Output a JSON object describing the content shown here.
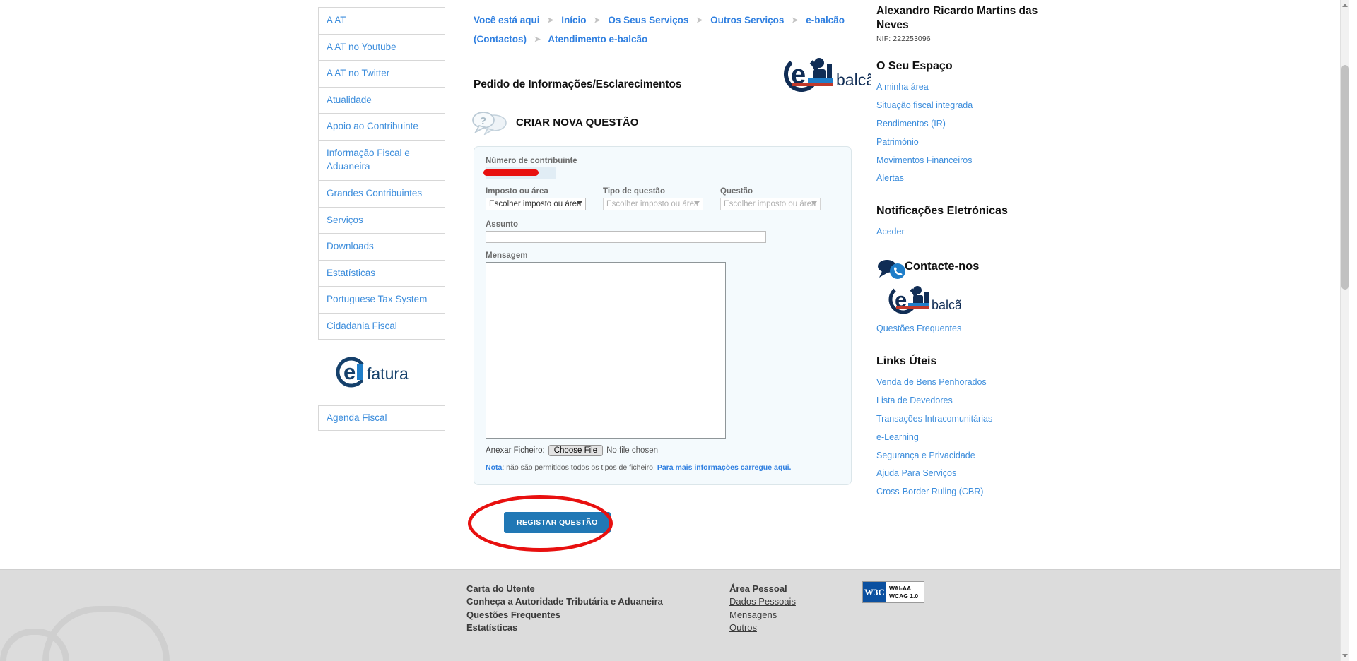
{
  "breadcrumb": {
    "prefix": "Você está aqui",
    "items": [
      "Início",
      "Os Seus Serviços",
      "Outros Serviços",
      "e-balcão (Contactos)",
      "Atendimento e-balcão"
    ]
  },
  "left_nav": {
    "items": [
      "A AT",
      "A AT no Youtube",
      "A AT no Twitter",
      "Atualidade",
      "Apoio ao Contribuinte",
      "Informação Fiscal e Aduaneira",
      "Grandes Contribuintes",
      "Serviços",
      "Downloads",
      "Estatísticas",
      "Portuguese Tax System",
      "Cidadania Fiscal"
    ],
    "efatura_logo_text": "efatura",
    "agenda": "Agenda Fiscal"
  },
  "main": {
    "page_title": "Pedido de Informações/Esclarecimentos",
    "logo_text": "balcão",
    "section_title": "CRIAR NOVA QUESTÃO",
    "form": {
      "nif_label": "Número de contribuinte",
      "nif_value": "",
      "imposto_label": "Imposto ou área",
      "imposto_value": "Escolher imposto ou área",
      "tipo_label": "Tipo de questão",
      "tipo_value": "Escolher imposto ou área",
      "questao_label": "Questão",
      "questao_value": "Escolher imposto ou área",
      "assunto_label": "Assunto",
      "assunto_value": "",
      "mensagem_label": "Mensagem",
      "mensagem_value": "",
      "attach_label": "Anexar Ficheiro:",
      "choose_file": "Choose File",
      "no_file": "No file chosen",
      "note_prefix": "Nota",
      "note_text": ": não são permitidos todos os tipos de ficheiro.",
      "note_link": "Para mais informações carregue aqui.",
      "submit": "REGISTAR QUESTÃO"
    }
  },
  "right": {
    "user_name": "Alexandro Ricardo Martins das Neves",
    "user_nif": "NIF: 222253096",
    "espaco_title": "O Seu Espaço",
    "espaco_links": [
      "A minha área",
      "Situação fiscal integrada",
      "Rendimentos (IR)",
      "Património",
      "Movimentos Financeiros",
      "Alertas"
    ],
    "notif_title": "Notificações Eletrónicas",
    "notif_links": [
      "Aceder"
    ],
    "contacte_title": "Contacte-nos",
    "contacte_logo_text": "balcão",
    "contacte_links": [
      "Questões Frequentes"
    ],
    "uteis_title": "Links Úteis",
    "uteis_links": [
      "Venda de Bens Penhorados",
      "Lista de Devedores",
      "Transações Intracomunitárias",
      "e-Learning",
      "Segurança e Privacidade",
      "Ajuda Para Serviços",
      "Cross-Border Ruling (CBR)"
    ]
  },
  "footer": {
    "col1": [
      "Carta do Utente",
      "Conheça a Autoridade Tributária e Aduaneira",
      "Questões Frequentes",
      "Estatísticas"
    ],
    "col2_title": "Área Pessoal",
    "col2": [
      "Dados Pessoais",
      "Mensagens",
      "Outros"
    ],
    "wcag_left": "W3C",
    "wcag_line1": "WAI-AA",
    "wcag_line2": "WCAG 1.0"
  },
  "colors": {
    "link_blue": "#3c8ddc",
    "breadcrumb_blue": "#2f7fe0",
    "button_blue": "#2178b5",
    "annotation_red": "#e8100f",
    "panel_bg": "#f4fafd",
    "footer_bg": "#dcdcdc"
  }
}
